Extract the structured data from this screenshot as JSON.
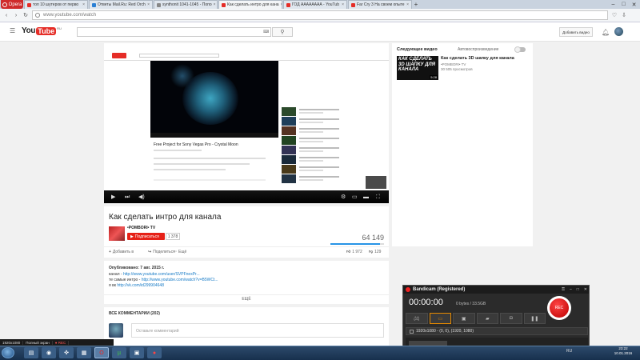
{
  "browser": {
    "menu_label": "Opera",
    "tabs": [
      {
        "label": "топ 10 шутеров от перво",
        "fav_color": "#e52d27",
        "active": false
      },
      {
        "label": "Ответы Mail.Ru: Red Orch",
        "fav_color": "#2a7fd4",
        "active": false
      },
      {
        "label": "synthonit 1041-1045 - Попо",
        "fav_color": "#888888",
        "active": false
      },
      {
        "label": "Как сделать интро для кана",
        "fav_color": "#e52d27",
        "active": true
      },
      {
        "label": "ГОД АААААААА - YouTub",
        "fav_color": "#e52d27",
        "active": false
      },
      {
        "label": "Far Cry 3 На своем опыте",
        "fav_color": "#e52d27",
        "active": false
      }
    ],
    "url": "www.youtube.com/watch"
  },
  "youtube": {
    "logo_you": "You",
    "logo_tube": "Tube",
    "logo_region": "RU",
    "add_video_label": "Добавить видео",
    "video_title": "Как сделать интро для канала",
    "channel_name": "•POMBORI• TV",
    "subscribe_label": "Подписаться",
    "subscriber_count": "1 378",
    "views": "64 149",
    "actions": {
      "add": "Добавить в",
      "share": "Поделиться",
      "more": "Ещё",
      "likes": "1 972",
      "dislikes": "129"
    },
    "description": {
      "published": "Опубликовано: 7 авг. 2015 г.",
      "lines": [
        {
          "prefix": "канал - ",
          "link": "http://www.youtube.com/user/SVPFnexPr..."
        },
        {
          "prefix": "те самые интро - ",
          "link": "http://www.youtube.com/watch?v=B5WCt..."
        },
        {
          "prefix": "я вк ",
          "link": "http://vk.com/id299904648"
        }
      ],
      "more_label": "ЕЩЁ"
    },
    "comments": {
      "header": "ВСЕ КОММЕНТАРИИ (202)",
      "placeholder": "Оставьте комментарий"
    },
    "up_next": {
      "heading": "Следующее видео",
      "autoplay_label": "Автовоспроизведение",
      "thumb_text": "КАК СДЕЛАТЬ 3D ШАПКУ ДЛЯ КАНАЛА",
      "duration": "5:28",
      "title": "Как сделать 3D шапку для канала",
      "channel": "•POMBORI• TV",
      "views": "30 505 просмотров"
    },
    "inner_page": {
      "video_title": "Free Project for Sony Vegas Pro - Crystal Moon"
    }
  },
  "bandicam": {
    "title": "Bandicam (Registered)",
    "timer": "00:00:00",
    "size": "0 bytes / 33.5GB",
    "rec_label": "REC",
    "mode": "1920x1080 - (0, 0), (1920, 1080)"
  },
  "display_bar": {
    "resolution": "1920x1080",
    "mode": "Полный экран",
    "rec": "● REC"
  },
  "taskbar": {
    "lang": "RU",
    "time": "23:22",
    "date": "10.01.2016"
  }
}
